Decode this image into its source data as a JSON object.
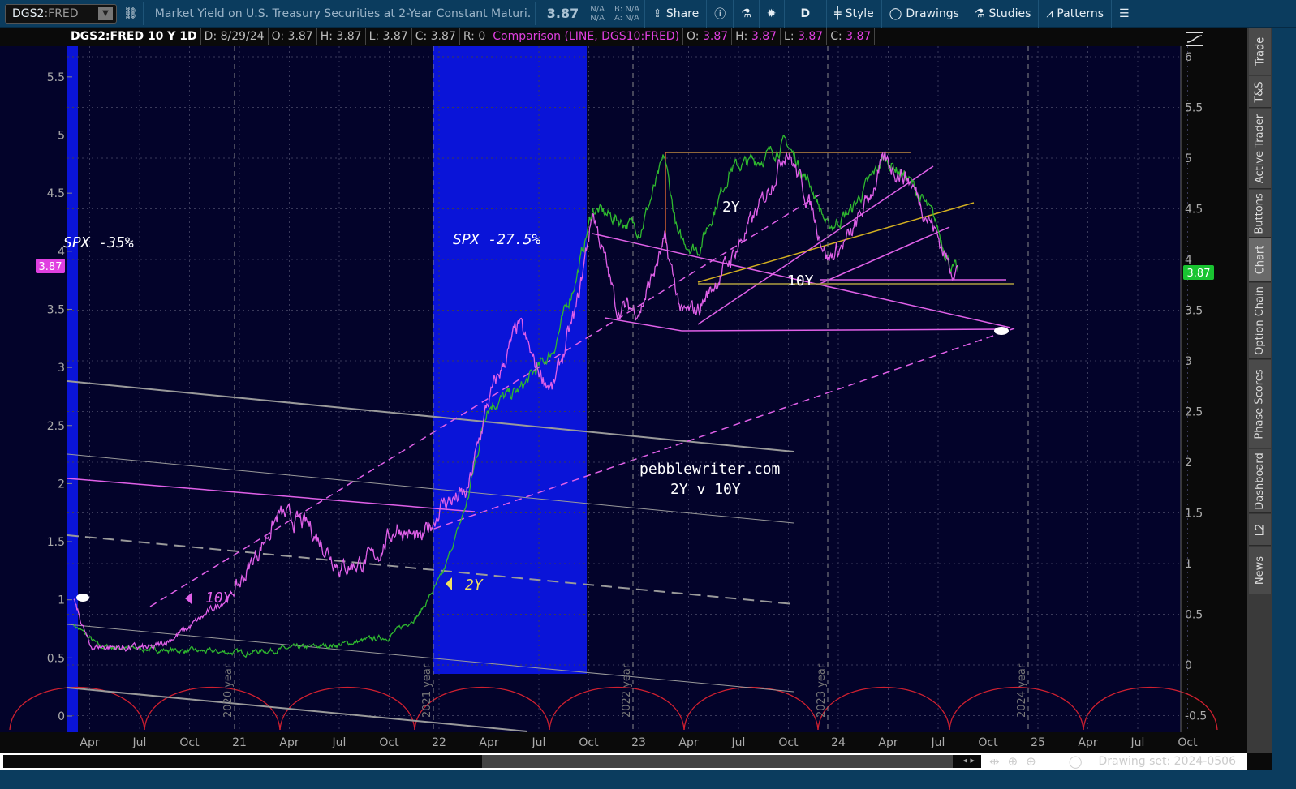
{
  "toolbar": {
    "symbol": "DGS2",
    "exchange": ":FRED",
    "description": "Market Yield on U.S. Treasury Securities at 2-Year Constant Maturi...",
    "last": "3.87",
    "bid_ask_left": [
      "N/A",
      "N/A"
    ],
    "bid_ask_right": [
      "B: N/A",
      "A: N/A"
    ],
    "share": "Share",
    "aggregation": "D",
    "style": "Style",
    "drawings": "Drawings",
    "studies": "Studies",
    "patterns": "Patterns"
  },
  "info": {
    "title": "DGS2:FRED 10 Y 1D",
    "date": "D: 8/29/24",
    "open": "O: 3.87",
    "high": "H: 3.87",
    "low": "L: 3.87",
    "close": "C: 3.87",
    "range": "R: 0",
    "comparison": "Comparison (LINE, DGS10:FRED)",
    "c_open_l": "O:",
    "c_open": "3.87",
    "c_high_l": "H:",
    "c_high": "3.87",
    "c_low_l": "L:",
    "c_low": "3.87",
    "c_close_l": "C:",
    "c_close": "3.87"
  },
  "sidebar": [
    "Trade",
    "T&S",
    "Active Trader",
    "Buttons",
    "Chart",
    "Option Chain",
    "Phase Scores",
    "Dashboard",
    "L2",
    "News"
  ],
  "scroll": {
    "drawing_set": "Drawing set: 2024-0506"
  },
  "annotations": {
    "spx1": "SPX -35%",
    "spx2": "SPX -27.5%",
    "l2y_top": "2Y",
    "l10y_top": "10Y",
    "l10y_bottom": "10Y",
    "l2y_bottom": "2Y",
    "site": "pebblewriter.com",
    "subtitle": "2Y v 10Y",
    "years": [
      "2020 year",
      "2021 year",
      "2022 year",
      "2023 year",
      "2024 year"
    ]
  },
  "colors": {
    "bg": "#03032a",
    "shade": "#0a14d8",
    "series_2y": "#2fb82f",
    "series_10y": "#e060e8",
    "badge_left": "#e040e0",
    "badge_right": "#19c431",
    "cycle": "#d02030"
  },
  "chart_data": {
    "type": "line",
    "title": "DGS2:FRED 10 Y 1D",
    "x_ticks": [
      {
        "x": 2020.25,
        "label": "Apr"
      },
      {
        "x": 2020.5,
        "label": "Jul"
      },
      {
        "x": 2020.75,
        "label": "Oct"
      },
      {
        "x": 2021,
        "label": "21"
      },
      {
        "x": 2021.25,
        "label": "Apr"
      },
      {
        "x": 2021.5,
        "label": "Jul"
      },
      {
        "x": 2021.75,
        "label": "Oct"
      },
      {
        "x": 2022,
        "label": "22"
      },
      {
        "x": 2022.25,
        "label": "Apr"
      },
      {
        "x": 2022.5,
        "label": "Jul"
      },
      {
        "x": 2022.75,
        "label": "Oct"
      },
      {
        "x": 2023,
        "label": "23"
      },
      {
        "x": 2023.25,
        "label": "Apr"
      },
      {
        "x": 2023.5,
        "label": "Jul"
      },
      {
        "x": 2023.75,
        "label": "Oct"
      },
      {
        "x": 2024,
        "label": "24"
      },
      {
        "x": 2024.25,
        "label": "Apr"
      },
      {
        "x": 2024.5,
        "label": "Jul"
      },
      {
        "x": 2024.75,
        "label": "Oct"
      },
      {
        "x": 2025,
        "label": "25"
      },
      {
        "x": 2025.25,
        "label": "Apr"
      },
      {
        "x": 2025.5,
        "label": "Jul"
      },
      {
        "x": 2025.75,
        "label": "Oct"
      }
    ],
    "left_axis": {
      "ticks": [
        "0",
        "0.5",
        "1",
        "1.5",
        "2",
        "2.5",
        "3",
        "3.5",
        "4",
        "4.5",
        "5",
        "5.5"
      ],
      "range": [
        0,
        5.5
      ]
    },
    "right_axis": {
      "ticks": [
        "-0.5",
        "0",
        "0.5",
        "1",
        "1.5",
        "2",
        "2.5",
        "3",
        "3.5",
        "4",
        "4.5",
        "5",
        "5.5",
        "6"
      ],
      "range": [
        -0.5,
        6
      ]
    },
    "series": [
      {
        "name": "DGS2:FRED (2Y)",
        "axis": "right",
        "last": "3.87",
        "points": [
          [
            2020.17,
            0.4
          ],
          [
            2020.3,
            0.18
          ],
          [
            2020.6,
            0.15
          ],
          [
            2021.0,
            0.12
          ],
          [
            2021.5,
            0.2
          ],
          [
            2021.75,
            0.28
          ],
          [
            2021.9,
            0.5
          ],
          [
            2022.02,
            0.9
          ],
          [
            2022.14,
            1.6
          ],
          [
            2022.24,
            2.56
          ],
          [
            2022.4,
            2.7
          ],
          [
            2022.57,
            3.1
          ],
          [
            2022.69,
            3.84
          ],
          [
            2022.77,
            4.5
          ],
          [
            2022.89,
            4.4
          ],
          [
            2023.01,
            4.3
          ],
          [
            2023.13,
            5.0
          ],
          [
            2023.2,
            4.2
          ],
          [
            2023.3,
            4.1
          ],
          [
            2023.46,
            4.9
          ],
          [
            2023.62,
            5.0
          ],
          [
            2023.74,
            5.15
          ],
          [
            2023.87,
            4.7
          ],
          [
            2023.95,
            4.3
          ],
          [
            2024.07,
            4.5
          ],
          [
            2024.23,
            5.0
          ],
          [
            2024.35,
            4.8
          ],
          [
            2024.48,
            4.4
          ],
          [
            2024.56,
            3.95
          ],
          [
            2024.6,
            3.87
          ]
        ]
      },
      {
        "name": "DGS10:FRED (10Y)",
        "axis": "left",
        "last": "3.87",
        "points": [
          [
            2020.17,
            1.0
          ],
          [
            2020.25,
            0.6
          ],
          [
            2020.57,
            0.58
          ],
          [
            2020.74,
            0.75
          ],
          [
            2020.98,
            1.07
          ],
          [
            2021.14,
            1.56
          ],
          [
            2021.2,
            1.73
          ],
          [
            2021.35,
            1.63
          ],
          [
            2021.51,
            1.28
          ],
          [
            2021.67,
            1.35
          ],
          [
            2021.79,
            1.63
          ],
          [
            2021.91,
            1.49
          ],
          [
            2022.02,
            1.84
          ],
          [
            2022.14,
            1.9
          ],
          [
            2022.24,
            2.67
          ],
          [
            2022.4,
            3.37
          ],
          [
            2022.48,
            3.02
          ],
          [
            2022.57,
            2.81
          ],
          [
            2022.69,
            3.51
          ],
          [
            2022.77,
            4.35
          ],
          [
            2022.89,
            3.51
          ],
          [
            2023.01,
            3.51
          ],
          [
            2023.13,
            4.07
          ],
          [
            2023.22,
            3.44
          ],
          [
            2023.3,
            3.51
          ],
          [
            2023.46,
            3.93
          ],
          [
            2023.62,
            4.42
          ],
          [
            2023.74,
            4.9
          ],
          [
            2023.87,
            4.35
          ],
          [
            2023.95,
            3.93
          ],
          [
            2024.07,
            4.14
          ],
          [
            2024.23,
            4.77
          ],
          [
            2024.35,
            4.63
          ],
          [
            2024.48,
            4.2
          ],
          [
            2024.56,
            3.86
          ],
          [
            2024.6,
            3.87
          ]
        ]
      }
    ]
  }
}
